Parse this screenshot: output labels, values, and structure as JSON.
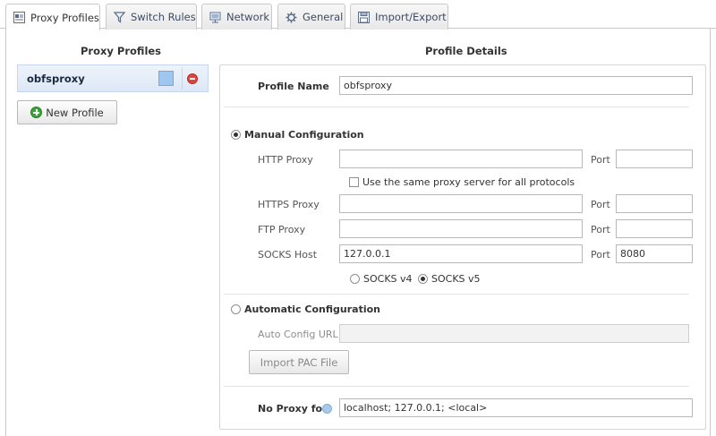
{
  "tabs": [
    {
      "label": "Proxy Profiles",
      "icon": "proxy-profiles-icon",
      "active": true
    },
    {
      "label": "Switch Rules",
      "icon": "funnel-icon",
      "active": false
    },
    {
      "label": "Network",
      "icon": "network-icon",
      "active": false
    },
    {
      "label": "General",
      "icon": "gear-icon",
      "active": false
    },
    {
      "label": "Import/Export",
      "icon": "floppy-disk-icon",
      "active": false
    }
  ],
  "left": {
    "title": "Proxy Profiles",
    "profile_name": "obfsproxy",
    "profile_color": "#9ec6ef",
    "new_profile_label": "New Profile"
  },
  "details": {
    "title": "Profile Details",
    "profile_name_label": "Profile Name",
    "profile_name_value": "obfsproxy",
    "manual_label": "Manual Configuration",
    "manual_selected": true,
    "http_proxy_label": "HTTP Proxy",
    "http_proxy_value": "",
    "http_port_value": "",
    "port_label": "Port",
    "same_proxy_label": "Use the same proxy server for all protocols",
    "same_proxy_checked": false,
    "https_proxy_label": "HTTPS Proxy",
    "https_proxy_value": "",
    "https_port_value": "",
    "ftp_proxy_label": "FTP Proxy",
    "ftp_proxy_value": "",
    "ftp_port_value": "",
    "socks_host_label": "SOCKS Host",
    "socks_host_value": "127.0.0.1",
    "socks_port_value": "8080",
    "socks_v4_label": "SOCKS v4",
    "socks_v5_label": "SOCKS v5",
    "socks_version_selected": "SOCKS v5",
    "auto_label": "Automatic Configuration",
    "auto_selected": false,
    "auto_url_label": "Auto Config URL",
    "auto_url_value": "",
    "import_pac_label": "Import PAC File",
    "no_proxy_label": "No Proxy for",
    "no_proxy_value": "localhost; 127.0.0.1; <local>"
  }
}
